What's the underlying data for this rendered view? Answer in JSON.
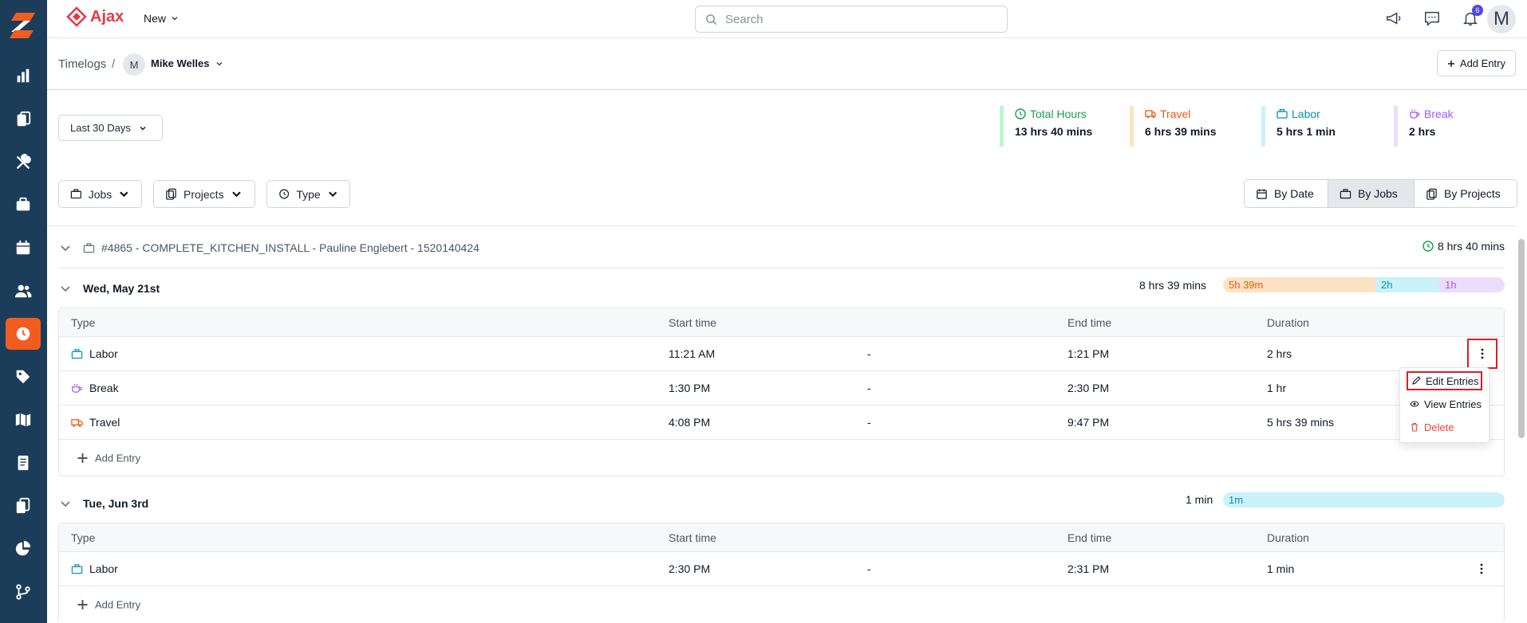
{
  "brand": {
    "name": "Ajax"
  },
  "topbar": {
    "new_label": "New",
    "search_placeholder": "Search",
    "notification_count": "6",
    "avatar_initial": "M"
  },
  "breadcrumb": {
    "root": "Timelogs",
    "separator": "/",
    "user_initial": "M",
    "user_name": "Mike Welles"
  },
  "actions": {
    "add_entry": "Add Entry"
  },
  "date_range": "Last 30 Days",
  "summary": [
    {
      "label": "Total Hours",
      "value": "13 hrs 40 mins",
      "color": "#16a34a",
      "bar_color": "#bbf7d0"
    },
    {
      "label": "Travel",
      "value": "6 hrs 39 mins",
      "color": "#ea580c",
      "bar_color": "#fde3c4"
    },
    {
      "label": "Labor",
      "value": "5 hrs 1 min",
      "color": "#0891b2",
      "bar_color": "#c9f2f9"
    },
    {
      "label": "Break",
      "value": "2 hrs",
      "color": "#a855f7",
      "bar_color": "#eddcfb"
    }
  ],
  "filters": {
    "jobs": "Jobs",
    "projects": "Projects",
    "type": "Type"
  },
  "views": {
    "by_date": "By Date",
    "by_jobs": "By Jobs",
    "by_projects": "By Projects"
  },
  "job": {
    "title": "#4865 - COMPLETE_KITCHEN_INSTALL - Pauline Englebert - 1520140424",
    "total": "8 hrs 40 mins"
  },
  "table_headers": {
    "type": "Type",
    "start": "Start time",
    "end": "End time",
    "duration": "Duration"
  },
  "days": [
    {
      "label": "Wed, May 21st",
      "total": "8 hrs 39 mins",
      "bar": [
        {
          "text": "5h 39m",
          "fraction": 0.541
        },
        {
          "text": "2h",
          "fraction": 0.227
        },
        {
          "text": "1h",
          "fraction": 0.232
        }
      ],
      "rows": [
        {
          "type": "Labor",
          "start": "11:21 AM",
          "dash": "-",
          "end": "1:21 PM",
          "duration": "2 hrs"
        },
        {
          "type": "Break",
          "start": "1:30 PM",
          "dash": "-",
          "end": "2:30 PM",
          "duration": "1 hr"
        },
        {
          "type": "Travel",
          "start": "4:08 PM",
          "dash": "-",
          "end": "9:47 PM",
          "duration": "5 hrs 39 mins"
        }
      ],
      "add_entry": "Add Entry"
    },
    {
      "label": "Tue, Jun 3rd",
      "total": "1 min",
      "bar": [
        {
          "text": "1m",
          "fraction": 1
        }
      ],
      "rows": [
        {
          "type": "Labor",
          "start": "2:30 PM",
          "dash": "-",
          "end": "2:31 PM",
          "duration": "1 min"
        }
      ],
      "add_entry": "Add Entry"
    }
  ],
  "menu": {
    "edit": "Edit Entries",
    "view": "View Entries",
    "delete": "Delete"
  }
}
